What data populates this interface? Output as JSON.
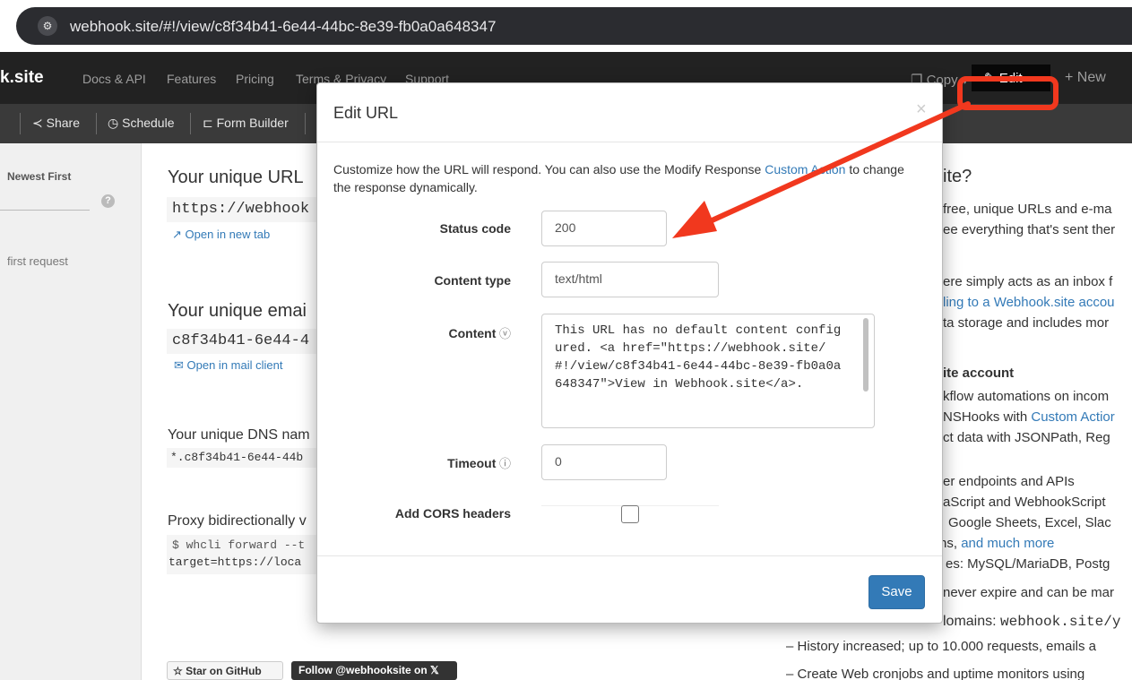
{
  "browser": {
    "url": "webhook.site/#!/view/c8f34b41-6e44-44bc-8e39-fb0a0a648347"
  },
  "navbar": {
    "brand": "k.site",
    "links": [
      "Docs & API",
      "Features",
      "Pricing",
      "Terms & Privacy",
      "Support"
    ],
    "copy_label": "Copy",
    "edit_label": "Edit",
    "new_label": "+ New"
  },
  "toolbar": {
    "share": "Share",
    "schedule": "Schedule",
    "form_builder": "Form Builder"
  },
  "sidebar": {
    "sort": "Newest First",
    "first_request": "first request"
  },
  "main": {
    "url_heading": "Your unique URL",
    "url_value": "https://webhook",
    "open_new_tab": "Open in new tab",
    "email_heading": "Your unique emai",
    "email_value": "c8f34b41-6e44-4",
    "open_mail": "Open in mail client",
    "dns_heading": "Your unique DNS nam",
    "dns_value": "*.c8f34b41-6e44-44b",
    "proxy_heading": "Proxy bidirectionally v",
    "proxy_cmd_1": "$ whcli forward --t",
    "proxy_cmd_2": "target=https://loca",
    "star_github": "Star on GitHub",
    "follow": "Follow @webhooksite on 𝕏"
  },
  "right": {
    "heading": "ite?",
    "line1": "free, unique URLs and e-ma",
    "line2": "ee everything that's sent ther",
    "line3": "ere simply acts as an inbox f",
    "line4": "ling to a Webhook.site accou",
    "line5": "ta storage and includes mor",
    "sub_heading": "ite account",
    "line6": "kflow automations on incom",
    "line7a": "NSHooks with ",
    "line7b": "Custom Actior",
    "line8": "ct data with JSONPath, Reg",
    "line9": "er endpoints and APIs",
    "line10": "aScript and WebhookScript",
    "line11": "Google Sheets, Excel, Slac",
    "line12a": "ns, ",
    "line12b": "and much more",
    "line13": "es: MySQL/MariaDB, Postg",
    "line14": "never expire and can be mar",
    "line15a": "lomains: ",
    "line15b": "webhook.site/y",
    "line16": "–  History increased; up to 10.000 requests, emails a",
    "line17": "–  Create Web cronjobs and uptime monitors using"
  },
  "modal": {
    "title": "Edit URL",
    "close": "×",
    "desc_text": "Customize how the URL will respond. You can also use the Modify Response ",
    "desc_link": "Custom Action",
    "desc_tail": " to change the response dynamically.",
    "status_label": "Status code",
    "status_value": "200",
    "content_type_label": "Content type",
    "content_type_value": "text/html",
    "content_label": "Content",
    "content_value": "This URL has no default content configured. <a href=\"https://webhook.site/#!/view/c8f34b41-6e44-44bc-8e39-fb0a0a648347\">View in Webhook.site</a>.",
    "timeout_label": "Timeout",
    "timeout_value": "0",
    "cors_label": "Add CORS headers",
    "save_label": "Save"
  },
  "colors": {
    "highlight": "#f1381e",
    "primary": "#337ab7"
  }
}
